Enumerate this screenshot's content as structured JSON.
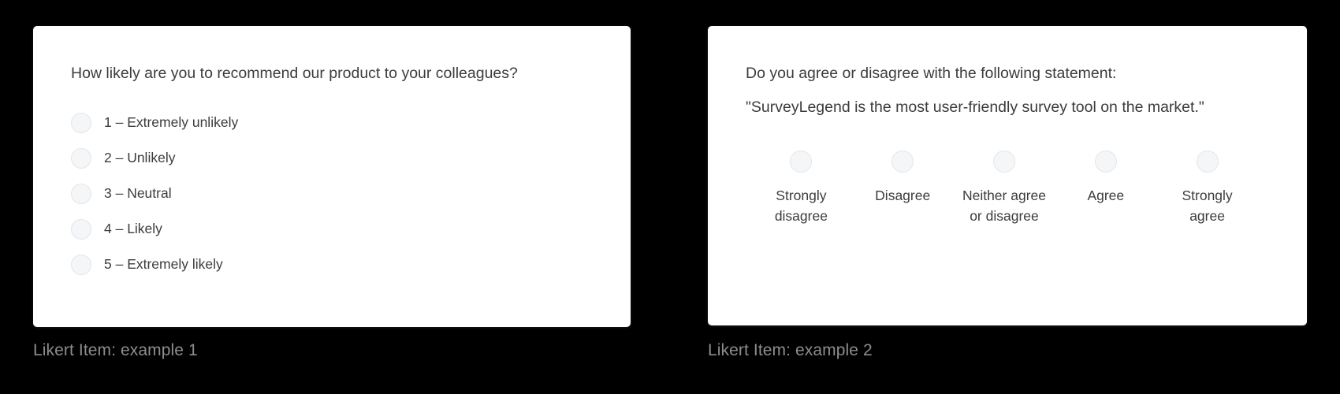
{
  "cards": [
    {
      "caption": "Likert Item: example 1",
      "question_lines": [
        "How likely are you to recommend our product to your colleagues?"
      ],
      "layout": "vertical",
      "options": [
        {
          "label": "1 – Extremely unlikely",
          "selected": false
        },
        {
          "label": "2 – Unlikely",
          "selected": false
        },
        {
          "label": "3 – Neutral",
          "selected": false
        },
        {
          "label": "4 – Likely",
          "selected": false
        },
        {
          "label": "5 – Extremely likely",
          "selected": false
        }
      ]
    },
    {
      "caption": "Likert Item: example 2",
      "question_lines": [
        "Do you agree or disagree with the following statement:",
        "\"SurveyLegend is the most user-friendly survey tool on the market.\""
      ],
      "layout": "horizontal",
      "options": [
        {
          "label": "Strongly disagree",
          "selected": false
        },
        {
          "label": "Disagree",
          "selected": false
        },
        {
          "label": "Neither agree or disagree",
          "selected": false
        },
        {
          "label": "Agree",
          "selected": false
        },
        {
          "label": "Strongly agree",
          "selected": false
        }
      ]
    }
  ],
  "colors": {
    "page_background": "#000000",
    "card_background": "#ffffff",
    "question_text": "#3c3c3c",
    "option_text": "#3c3c3c",
    "caption_text": "#8d8d8d",
    "radio_fill": "#f4f6f8",
    "radio_border": "#e3e6ea"
  }
}
